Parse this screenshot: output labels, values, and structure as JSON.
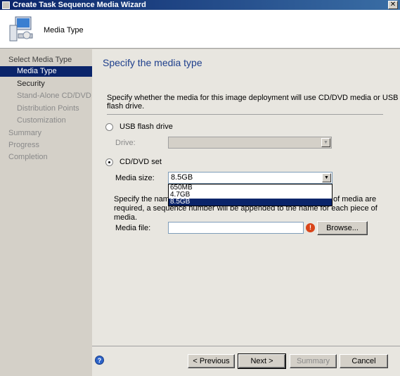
{
  "window": {
    "title": "Create Task Sequence Media Wizard",
    "close_glyph": "✕"
  },
  "header": {
    "title": "Media Type"
  },
  "sidebar": {
    "items": [
      {
        "label": "Select Media Type",
        "level": 0,
        "state": "normal"
      },
      {
        "label": "Media Type",
        "level": 1,
        "state": "selected"
      },
      {
        "label": "Security",
        "level": 1,
        "state": "dark"
      },
      {
        "label": "Stand-Alone CD/DVD",
        "level": 1,
        "state": "dim"
      },
      {
        "label": "Distribution Points",
        "level": 1,
        "state": "dim"
      },
      {
        "label": "Customization",
        "level": 1,
        "state": "dim"
      },
      {
        "label": "Summary",
        "level": 0,
        "state": "dim"
      },
      {
        "label": "Progress",
        "level": 0,
        "state": "dim"
      },
      {
        "label": "Completion",
        "level": 0,
        "state": "dim"
      }
    ]
  },
  "main": {
    "page_title": "Specify the media type",
    "instruction": "Specify whether the media for this image deployment will use CD/DVD media or USB flash drive.",
    "usb_option": {
      "label": "USB flash drive",
      "checked": false
    },
    "drive_label": "Drive:",
    "drive_value": "",
    "cddvd_option": {
      "label": "CD/DVD set",
      "checked": true
    },
    "media_size_label": "Media size:",
    "media_size_value": "8.5GB",
    "media_size_options": [
      "650MB",
      "4.7GB",
      "8.5GB"
    ],
    "media_size_selected_index": 2,
    "para_visible_left": "Specify the name an",
    "para_visible_right": "of media are",
    "para_line2": "required, a sequence number will be appended to the name for each piece of media.",
    "media_file_label": "Media file:",
    "media_file_value": "",
    "error_glyph": "!",
    "browse_label": "Browse..."
  },
  "footer": {
    "help_glyph": "?",
    "previous_label": "< Previous",
    "next_label": "Next >",
    "summary_label": "Summary",
    "cancel_label": "Cancel"
  },
  "colors": {
    "title_bar": "#0a246a",
    "selected": "#0a246a",
    "page_title": "#1e3f8c",
    "error": "#d9451a"
  }
}
